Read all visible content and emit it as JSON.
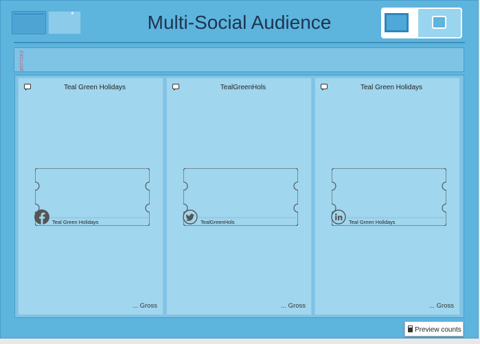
{
  "header": {
    "title": "Multi-Social Audience"
  },
  "exclude": {
    "label": "EXCLUDE"
  },
  "columns": [
    {
      "title": "Teal Green Holidays",
      "label": "Teal Green Holidays",
      "footer": "... Gross",
      "icon": "facebook-icon"
    },
    {
      "title": "TealGreenHols",
      "label": "TealGreenHols",
      "footer": "... Gross",
      "icon": "twitter-icon"
    },
    {
      "title": "Teal Green Holidays",
      "label": "Teal Green Holidays",
      "footer": "... Gross",
      "icon": "linkedin-icon"
    }
  ],
  "preview_button": {
    "label": "Preview counts"
  },
  "colors": {
    "background": "#5db4dd",
    "column": "#a0d6ee",
    "icon": "#555555"
  }
}
